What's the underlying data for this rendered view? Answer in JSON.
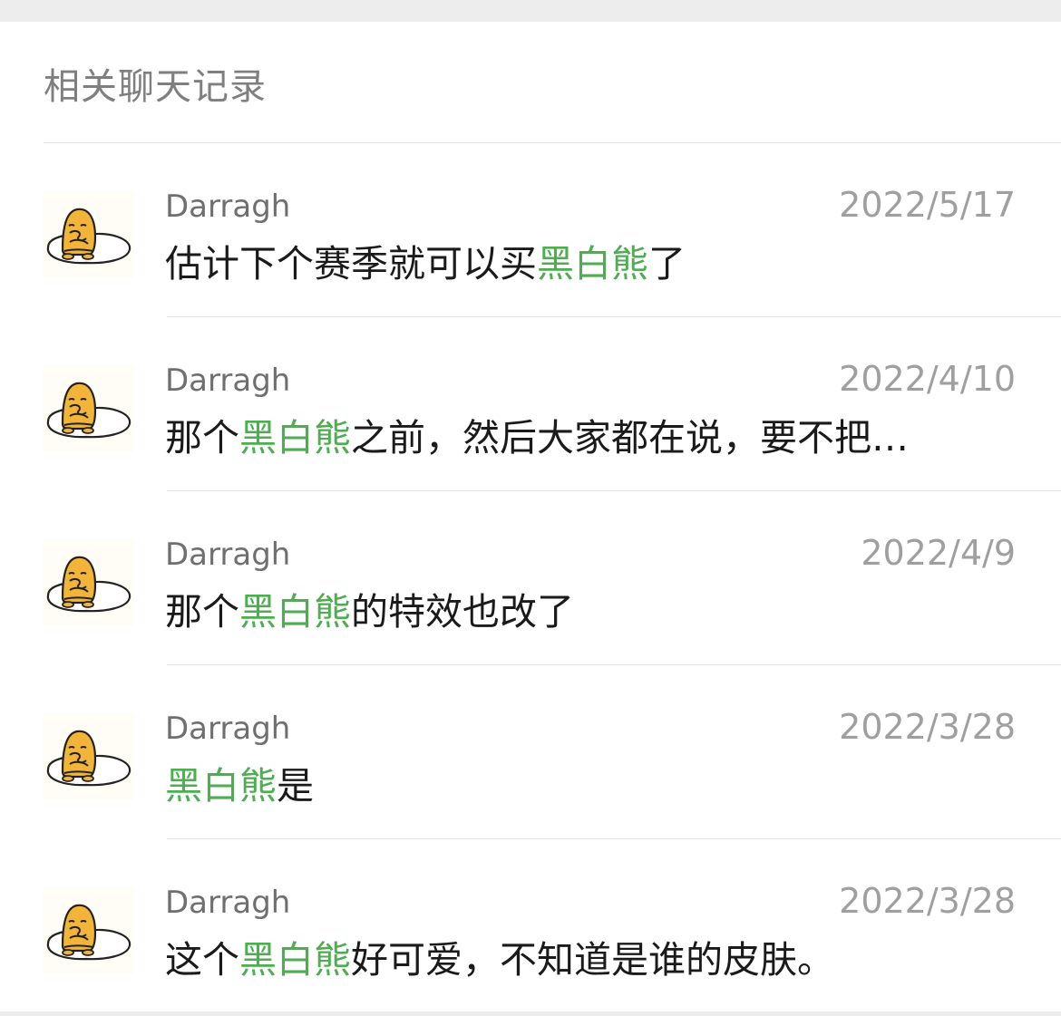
{
  "section": {
    "title": "相关聊天记录"
  },
  "highlight_color": "#4cae4f",
  "avatar_icon": "gudetama-egg-icon",
  "results": [
    {
      "sender": "Darragh",
      "date": "2022/5/17",
      "pre": "估计下个赛季就可以买",
      "match": "黑白熊",
      "post": "了"
    },
    {
      "sender": "Darragh",
      "date": "2022/4/10",
      "pre": "那个",
      "match": "黑白熊",
      "post": "之前，然后大家都在说，要不把…"
    },
    {
      "sender": "Darragh",
      "date": "2022/4/9",
      "pre": "那个",
      "match": "黑白熊",
      "post": "的特效也改了"
    },
    {
      "sender": "Darragh",
      "date": "2022/3/28",
      "pre": "",
      "match": "黑白熊",
      "post": "是"
    },
    {
      "sender": "Darragh",
      "date": "2022/3/28",
      "pre": "这个",
      "match": "黑白熊",
      "post": "好可爱，不知道是谁的皮肤。"
    }
  ]
}
